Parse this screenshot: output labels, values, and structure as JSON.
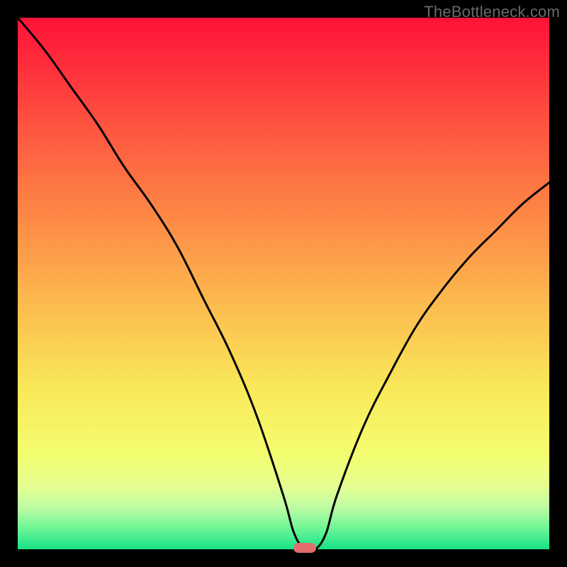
{
  "watermark": "TheBottleneck.com",
  "chart_data": {
    "type": "line",
    "title": "",
    "xlabel": "",
    "ylabel": "",
    "xlim": [
      0,
      100
    ],
    "ylim": [
      0,
      100
    ],
    "grid": false,
    "legend": false,
    "annotations": [
      {
        "name": "sweet-spot-marker",
        "x": 54,
        "y": 0,
        "color": "#e26d6d"
      }
    ],
    "background_gradient": {
      "direction": "vertical",
      "stops": [
        {
          "pos": 0,
          "color": "#ff1238"
        },
        {
          "pos": 22,
          "color": "#fe5940"
        },
        {
          "pos": 54,
          "color": "#fcbb4e"
        },
        {
          "pos": 82,
          "color": "#f4fd6f"
        },
        {
          "pos": 100,
          "color": "#17e387"
        }
      ]
    },
    "series": [
      {
        "name": "bottleneck-curve",
        "x": [
          0,
          5,
          10,
          15,
          20,
          25,
          30,
          35,
          40,
          45,
          50,
          52,
          54,
          56,
          58,
          60,
          65,
          70,
          75,
          80,
          85,
          90,
          95,
          100
        ],
        "values": [
          100,
          94,
          87,
          80,
          72,
          65,
          57,
          47,
          37,
          25,
          10,
          3,
          0,
          0,
          3,
          10,
          23,
          33,
          42,
          49,
          55,
          60,
          65,
          69
        ]
      }
    ]
  }
}
